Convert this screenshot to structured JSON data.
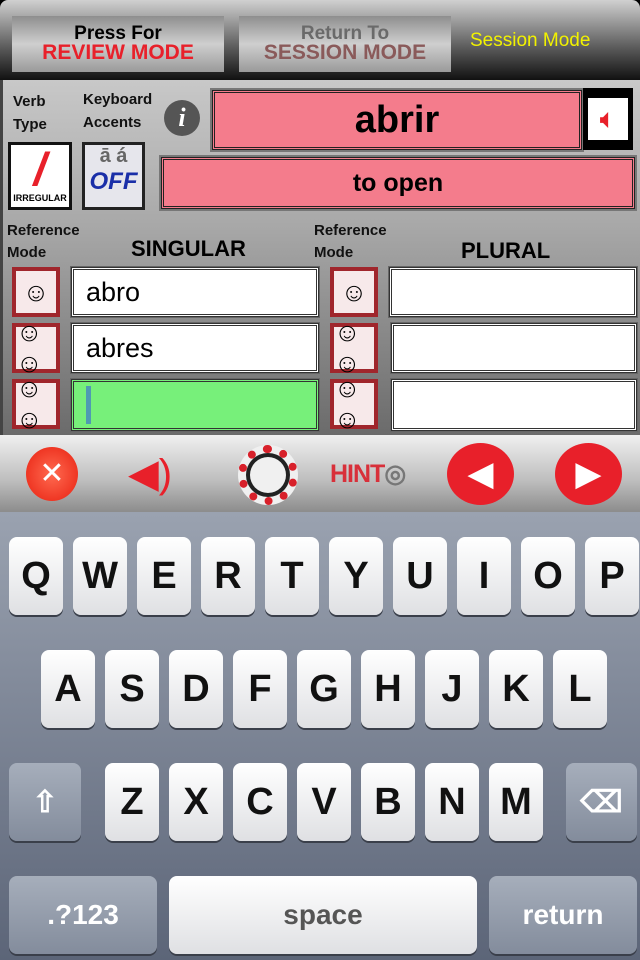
{
  "header": {
    "review_btn": {
      "line1": "Press For",
      "line2": "REVIEW MODE"
    },
    "return_btn": {
      "line1": "Return To",
      "line2": "SESSION MODE"
    },
    "mode_label": "Session Mode"
  },
  "verb": {
    "verb_type_label": "Verb Type",
    "keyboard_accents_label": "Keyboard Accents",
    "irregular_badge": "IRREGULAR",
    "accents_glyphs": "ā á",
    "accents_state": "OFF",
    "infinitive": "abrir",
    "translation": "to open"
  },
  "conjugation": {
    "ref_mode_label": "Reference Mode",
    "singular_header": "SINGULAR",
    "plural_header": "PLURAL",
    "singular": [
      "abro",
      "abres",
      ""
    ],
    "plural": [
      "",
      "",
      ""
    ]
  },
  "toolbar": {
    "hint_label": "HINT"
  },
  "keyboard": {
    "row1": [
      "Q",
      "W",
      "E",
      "R",
      "T",
      "Y",
      "U",
      "I",
      "O",
      "P"
    ],
    "row2": [
      "A",
      "S",
      "D",
      "F",
      "G",
      "H",
      "J",
      "K",
      "L"
    ],
    "row3": [
      "Z",
      "X",
      "C",
      "V",
      "B",
      "N",
      "M"
    ],
    "numbers": ".?123",
    "space": "space",
    "return": "return"
  },
  "colors": {
    "accent": "#e8202a",
    "field_pink": "#f47c8c",
    "active_green": "#77f07a",
    "mode_yellow": "#f2f200"
  }
}
